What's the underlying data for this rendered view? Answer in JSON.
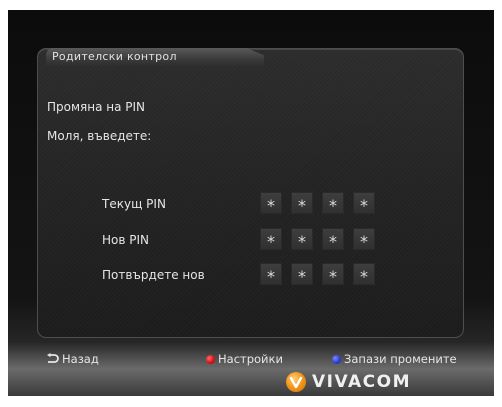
{
  "dialog": {
    "title": "Родителски контрол",
    "subtitle": "Промяна на PIN",
    "prompt": "Моля, въведете:"
  },
  "fields": [
    {
      "label": "Текущ PIN",
      "digits": [
        "*",
        "*",
        "*",
        "*"
      ]
    },
    {
      "label": "Нов PIN",
      "digits": [
        "*",
        "*",
        "*",
        "*"
      ]
    },
    {
      "label": "Потвърдете нов",
      "digits": [
        "*",
        "*",
        "*",
        "*"
      ]
    }
  ],
  "footer": {
    "back": {
      "label": "Назад",
      "icon": "back-arrow-icon"
    },
    "settings": {
      "label": "Настройки",
      "color": "#e01616"
    },
    "save": {
      "label": "Запази промените",
      "color": "#2a3bd0"
    }
  },
  "brand": {
    "logo_text": "VIVACOM",
    "logo_color": "#f29a1c"
  }
}
